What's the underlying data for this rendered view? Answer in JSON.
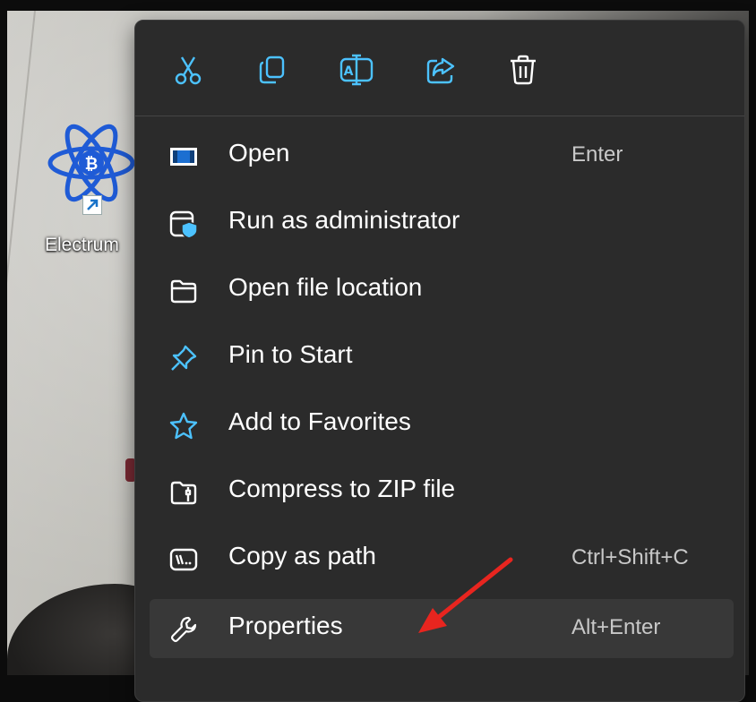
{
  "desktop": {
    "shortcut_label": "Electrum"
  },
  "context_menu": {
    "toolbar": [
      {
        "name": "cut-icon",
        "tooltip": "Cut"
      },
      {
        "name": "copy-icon",
        "tooltip": "Copy"
      },
      {
        "name": "rename-icon",
        "tooltip": "Rename"
      },
      {
        "name": "share-icon",
        "tooltip": "Share"
      },
      {
        "name": "delete-icon",
        "tooltip": "Delete"
      }
    ],
    "items": [
      {
        "label": "Open",
        "shortcut": "Enter"
      },
      {
        "label": "Run as administrator",
        "shortcut": ""
      },
      {
        "label": "Open file location",
        "shortcut": ""
      },
      {
        "label": "Pin to Start",
        "shortcut": ""
      },
      {
        "label": "Add to Favorites",
        "shortcut": ""
      },
      {
        "label": "Compress to ZIP file",
        "shortcut": ""
      },
      {
        "label": "Copy as path",
        "shortcut": "Ctrl+Shift+C"
      },
      {
        "label": "Properties",
        "shortcut": "Alt+Enter"
      }
    ],
    "highlighted_item": "Properties"
  },
  "colors": {
    "menu_bg": "#2b2b2b",
    "accent_blue": "#4cc2ff",
    "annotation_red": "#e8251f"
  }
}
